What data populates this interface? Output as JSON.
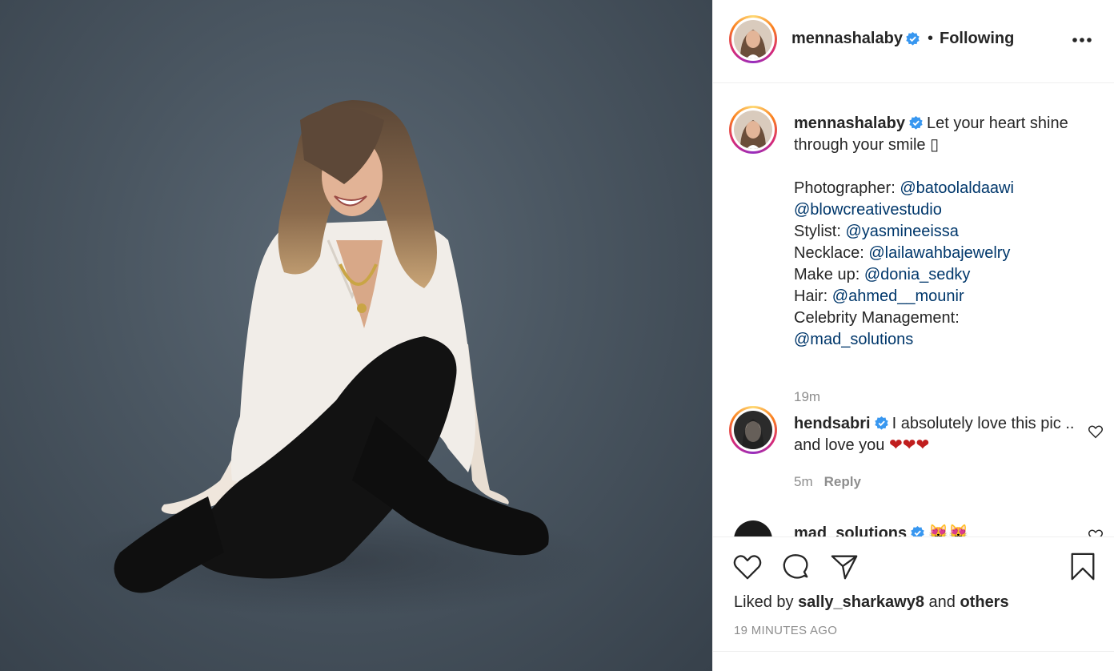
{
  "post": {
    "author": "mennashalaby",
    "follow_state": "Following",
    "dot": "•"
  },
  "caption": {
    "username": "mennashalaby",
    "lines": [
      "Let your heart shine",
      "through your smile ▯",
      "",
      "Photographer: ",
      "",
      "Stylist: ",
      "Necklace: ",
      "Make up: ",
      "Hair: ",
      "Celebrity Management:",
      ""
    ],
    "mentions": {
      "photographer": "@batoolaldaawi",
      "studio": "@blowcreativestudio",
      "stylist": "@yasmineeissa",
      "necklace": "@lailawahbajewelry",
      "makeup": "@donia_sedky",
      "hair": "@ahmed__mounir",
      "management": "@mad_solutions"
    },
    "time": "19m"
  },
  "comments": [
    {
      "username": "hendsabri",
      "text": "I absolutely love this pic .. and love you",
      "hearts": "❤❤❤",
      "time": "5m",
      "reply_label": "Reply"
    },
    {
      "username": "mad_solutions",
      "text": "😻😻"
    }
  ],
  "likes": {
    "prefix": "Liked by",
    "user": "sally_sharkawy8",
    "conj": "and",
    "others": "others"
  },
  "timestamp": "19 MINUTES AGO",
  "colors": {
    "mention": "#00376b",
    "verified": "#3897f0",
    "muted": "#8e8e8e",
    "heart": "#ed4956"
  },
  "icons": [
    "more-icon",
    "verified-icon",
    "heart-icon",
    "comment-icon",
    "share-icon",
    "bookmark-icon"
  ]
}
